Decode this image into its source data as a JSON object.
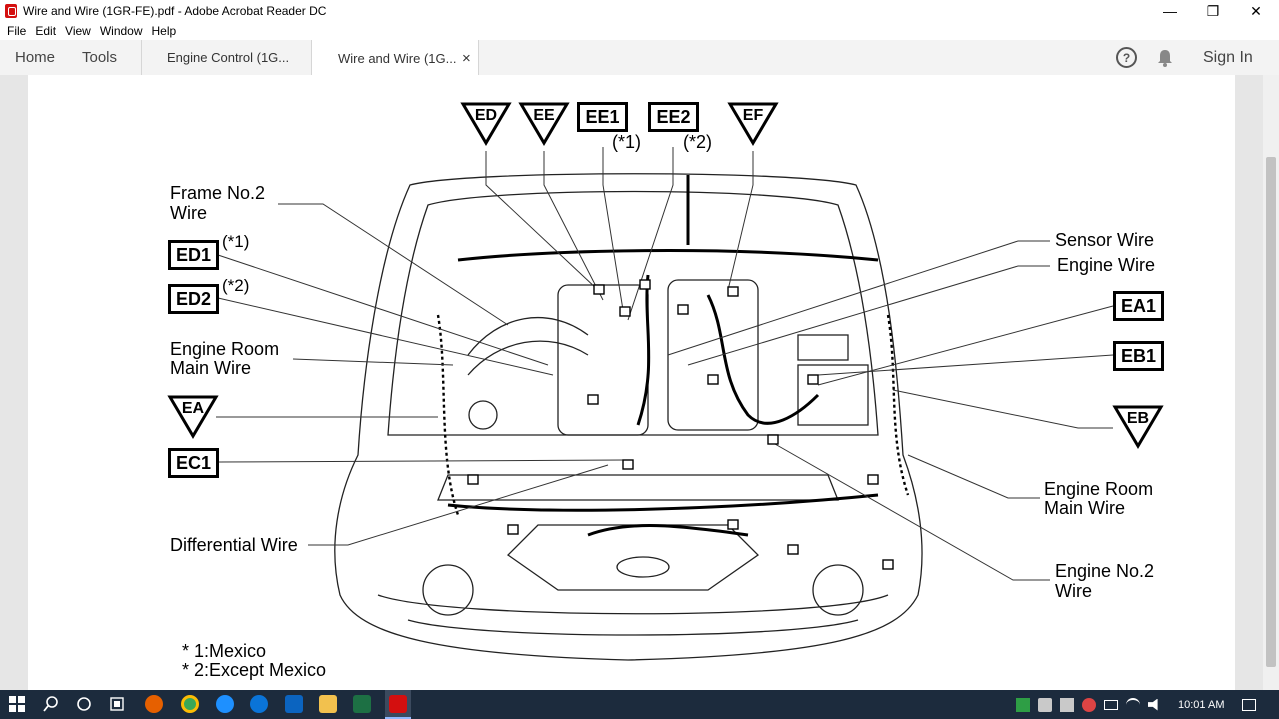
{
  "window": {
    "title": "Wire and Wire (1GR-FE).pdf - Adobe Acrobat Reader DC",
    "minimize": "—",
    "maximize": "❐",
    "close": "✕"
  },
  "menu": [
    "File",
    "Edit",
    "View",
    "Window",
    "Help"
  ],
  "tabs": {
    "home": "Home",
    "tools": "Tools",
    "doc1": "Engine Control (1G...",
    "doc2": "Wire and Wire (1G...",
    "doc_close": "×",
    "help": "?",
    "sign_in": "Sign In"
  },
  "diagram": {
    "triangles": [
      "ED",
      "EE",
      "EF",
      "EA",
      "EB"
    ],
    "boxes": [
      "EE1",
      "EE2",
      "ED1",
      "ED2",
      "EC1",
      "EA1",
      "EB1"
    ],
    "notes": {
      "ee1": "(*1)",
      "ee2": "(*2)",
      "ed1": "(*1)",
      "ed2": "(*2)"
    },
    "labels": {
      "frame_no2_l1": "Frame No.2",
      "frame_no2_l2": "Wire",
      "engine_room_main_l1": "Engine Room",
      "engine_room_main_l2": "Main Wire",
      "differential": "Differential Wire",
      "sensor": "Sensor Wire",
      "engine": "Engine Wire",
      "engine_room_main_r_l1": "Engine Room",
      "engine_room_main_r_l2": "Main Wire",
      "engine_no2_l1": "Engine No.2",
      "engine_no2_l2": "Wire"
    },
    "footnotes": [
      "* 1:Mexico",
      "* 2:Except Mexico"
    ]
  },
  "taskbar": {
    "time": "10:01 AM"
  }
}
